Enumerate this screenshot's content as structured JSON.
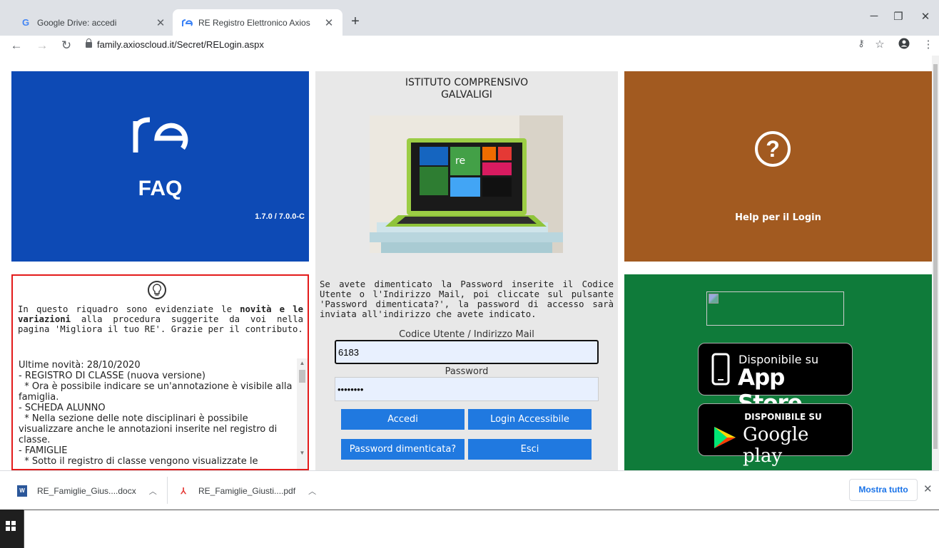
{
  "browser": {
    "tabs": [
      {
        "title": "Google Drive: accedi",
        "favicon": "google-g-icon",
        "active": false
      },
      {
        "title": "RE Registro Elettronico Axios",
        "favicon": "re-icon",
        "active": true
      }
    ],
    "url": "family.axioscloud.it/Secret/RELogin.aspx"
  },
  "faq": {
    "logo": "re",
    "label": "FAQ",
    "version": "1.7.0 / 7.0.0-C",
    "color": "#0d4ab5"
  },
  "school": {
    "name_line1": "ISTITUTO COMPRENSIVO",
    "name_line2": "GALVALIGI"
  },
  "login": {
    "info": "Se avete dimenticato la Password inserite il Codice Utente o l'Indirizzo Mail, poi cliccate sul pulsante 'Password dimenticata?', la password di accesso sarà inviata all'indirizzo che avete indicato.",
    "user_label": "Codice Utente / Indirizzo Mail",
    "user_value": "6183",
    "password_label": "Password",
    "password_value": "12345678",
    "buttons": {
      "accedi": "Accedi",
      "accessibile": "Login Accessibile",
      "dimenticata": "Password dimenticata?",
      "esci": "Esci"
    },
    "button_color": "#2079e0"
  },
  "help": {
    "label": "Help per il Login",
    "color": "#a25a20"
  },
  "news": {
    "intro_pre": "In questo riquadro sono evidenziate le ",
    "intro_bold": "novità e le variazioni",
    "intro_post": " alla procedura suggerite da voi nella pagina 'Migliora il tuo RE'. Grazie per il contributo.",
    "body": "Ultime novità: 28/10/2020\n- REGISTRO DI CLASSE (nuova versione)\n  * Ora è possibile indicare se un'annotazione è visibile alla famiglia.\n- SCHEDA ALUNNO\n  * Nella sezione delle note disciplinari è possibile visualizzare anche le annotazioni inserite nel registro di classe.\n- FAMIGLIE\n  * Sotto il registro di classe vengono visualizzate le"
  },
  "apps": {
    "appstore_small": "Disponibile su",
    "appstore_big": "App Store",
    "gplay_small": "DISPONIBILE SU",
    "gplay_big": "Google play",
    "color": "#0f7b3a"
  },
  "downloads": {
    "items": [
      {
        "name": "RE_Famiglie_Gius....docx",
        "icon": "word-doc-icon"
      },
      {
        "name": "RE_Famiglie_Giusti....pdf",
        "icon": "pdf-icon"
      }
    ],
    "show_all": "Mostra tutto"
  }
}
